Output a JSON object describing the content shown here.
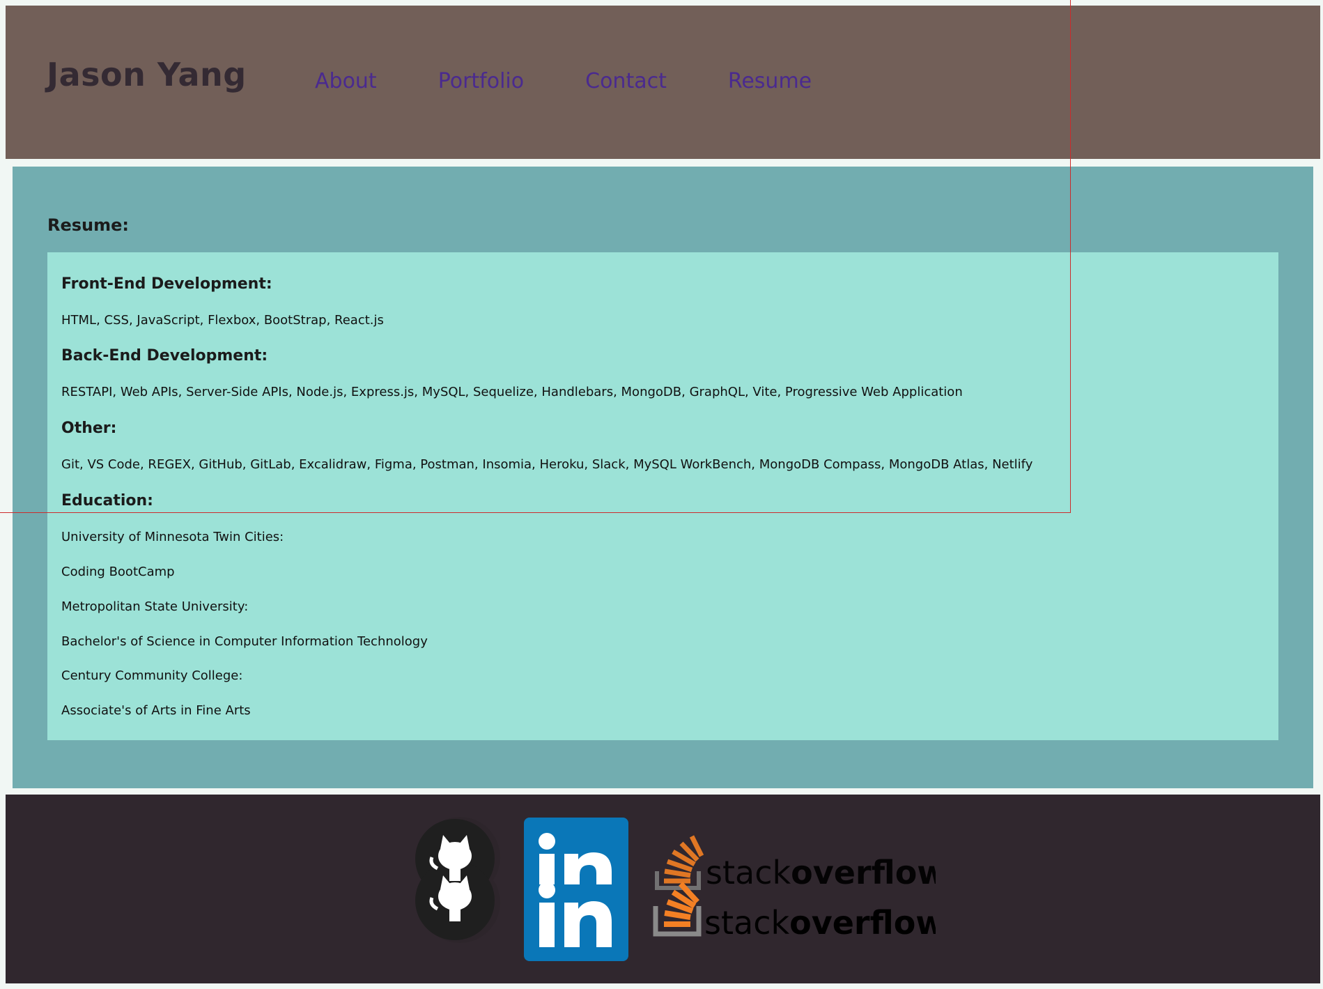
{
  "header": {
    "brand": "Jason Yang",
    "nav": [
      {
        "label": "About"
      },
      {
        "label": "Portfolio"
      },
      {
        "label": "Contact"
      },
      {
        "label": "Resume"
      }
    ],
    "background": "#725f58",
    "brand_color": "#342a33",
    "nav_color": "#4a2a8f"
  },
  "main": {
    "title": "Resume:",
    "background": "#72adb0",
    "card_background": "#9ce2d7",
    "sections": {
      "frontend": {
        "heading": "Front-End Development:",
        "text": "HTML, CSS, JavaScript, Flexbox, BootStrap, React.js"
      },
      "backend": {
        "heading": "Back-End Development:",
        "text": "RESTAPI, Web APIs, Server-Side APIs, Node.js, Express.js, MySQL, Sequelize, Handlebars, MongoDB, GraphQL, Vite, Progressive Web Application"
      },
      "other": {
        "heading": "Other:",
        "text": "Git, VS Code, REGEX, GitHub, GitLab, Excalidraw, Figma, Postman, Insomia, Heroku, Slack, MySQL WorkBench, MongoDB Compass, MongoDB Atlas, Netlify"
      },
      "education": {
        "heading": "Education:",
        "items": [
          "University of Minnesota Twin Cities:",
          "Coding BootCamp",
          "Metropolitan State University:",
          "Bachelor's of Science in Computer Information Technology",
          "Century Community College:",
          "Associate's of Arts in Fine Arts"
        ]
      }
    }
  },
  "footer": {
    "background": "#30272e",
    "icons": {
      "github": "github-icon",
      "linkedin": "linkedin-icon",
      "stackoverflow": "stackoverflow-icon"
    },
    "linkedin_color": "#0a77b8",
    "stackoverflow_text_light": "stack",
    "stackoverflow_text_bold": "overflow"
  }
}
